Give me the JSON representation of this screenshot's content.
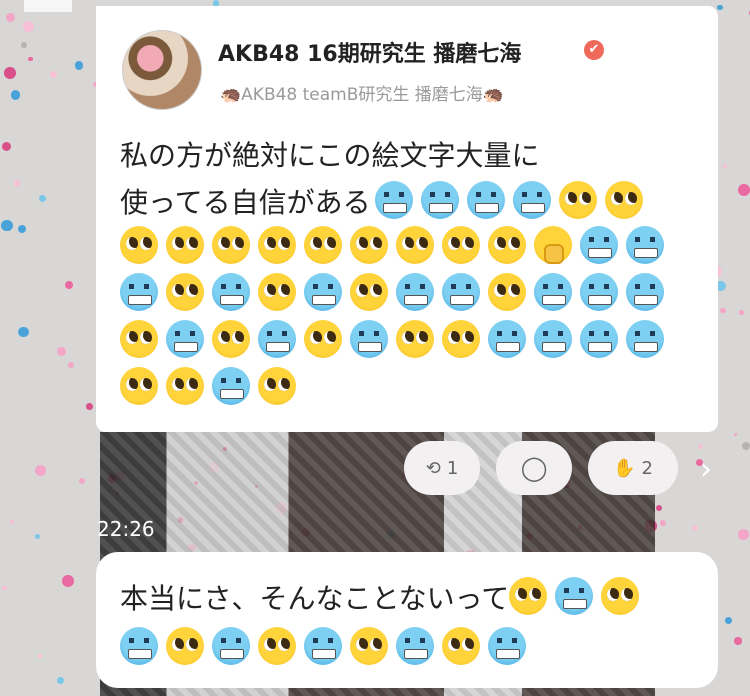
{
  "post": {
    "author_name": "AKB48 16期研究生  播磨七海",
    "verified_icon": "✔",
    "subtitle": "🦔AKB48 teamB研究生  播磨七海🦔",
    "text_line1": "私の方が絶対にこの絵文字大量に",
    "text_line2": "使ってる自信がある",
    "emojis": [
      "cold",
      "cold",
      "cold",
      "cold",
      "pleading",
      "pleading",
      "pleading",
      "pleading",
      "pleading",
      "pleading",
      "pleading",
      "pleading",
      "pleading",
      "pleading",
      "pleading",
      "hand",
      "cold",
      "cold",
      "cold",
      "pleading",
      "cold",
      "pleading",
      "cold",
      "pleading",
      "cold",
      "cold",
      "pleading",
      "cold",
      "cold",
      "cold",
      "pleading",
      "cold",
      "pleading",
      "cold",
      "pleading",
      "cold",
      "pleading",
      "pleading",
      "cold",
      "cold",
      "cold",
      "cold",
      "pleading",
      "pleading",
      "cold",
      "pleading"
    ]
  },
  "actions": {
    "retweet_count": "1",
    "clap_count": "2"
  },
  "timestamp": "22:26",
  "reply": {
    "text": "本当にさ、そんなことないって",
    "emojis_line1": [
      "pleading",
      "cold",
      "pleading"
    ],
    "emojis_line2": [
      "cold",
      "pleading",
      "cold",
      "pleading",
      "cold",
      "pleading",
      "cold",
      "pleading",
      "cold"
    ]
  },
  "colors": {
    "verified": "#f06a5b",
    "bubble": "#ffffff",
    "pill": "#f2f0f0"
  }
}
